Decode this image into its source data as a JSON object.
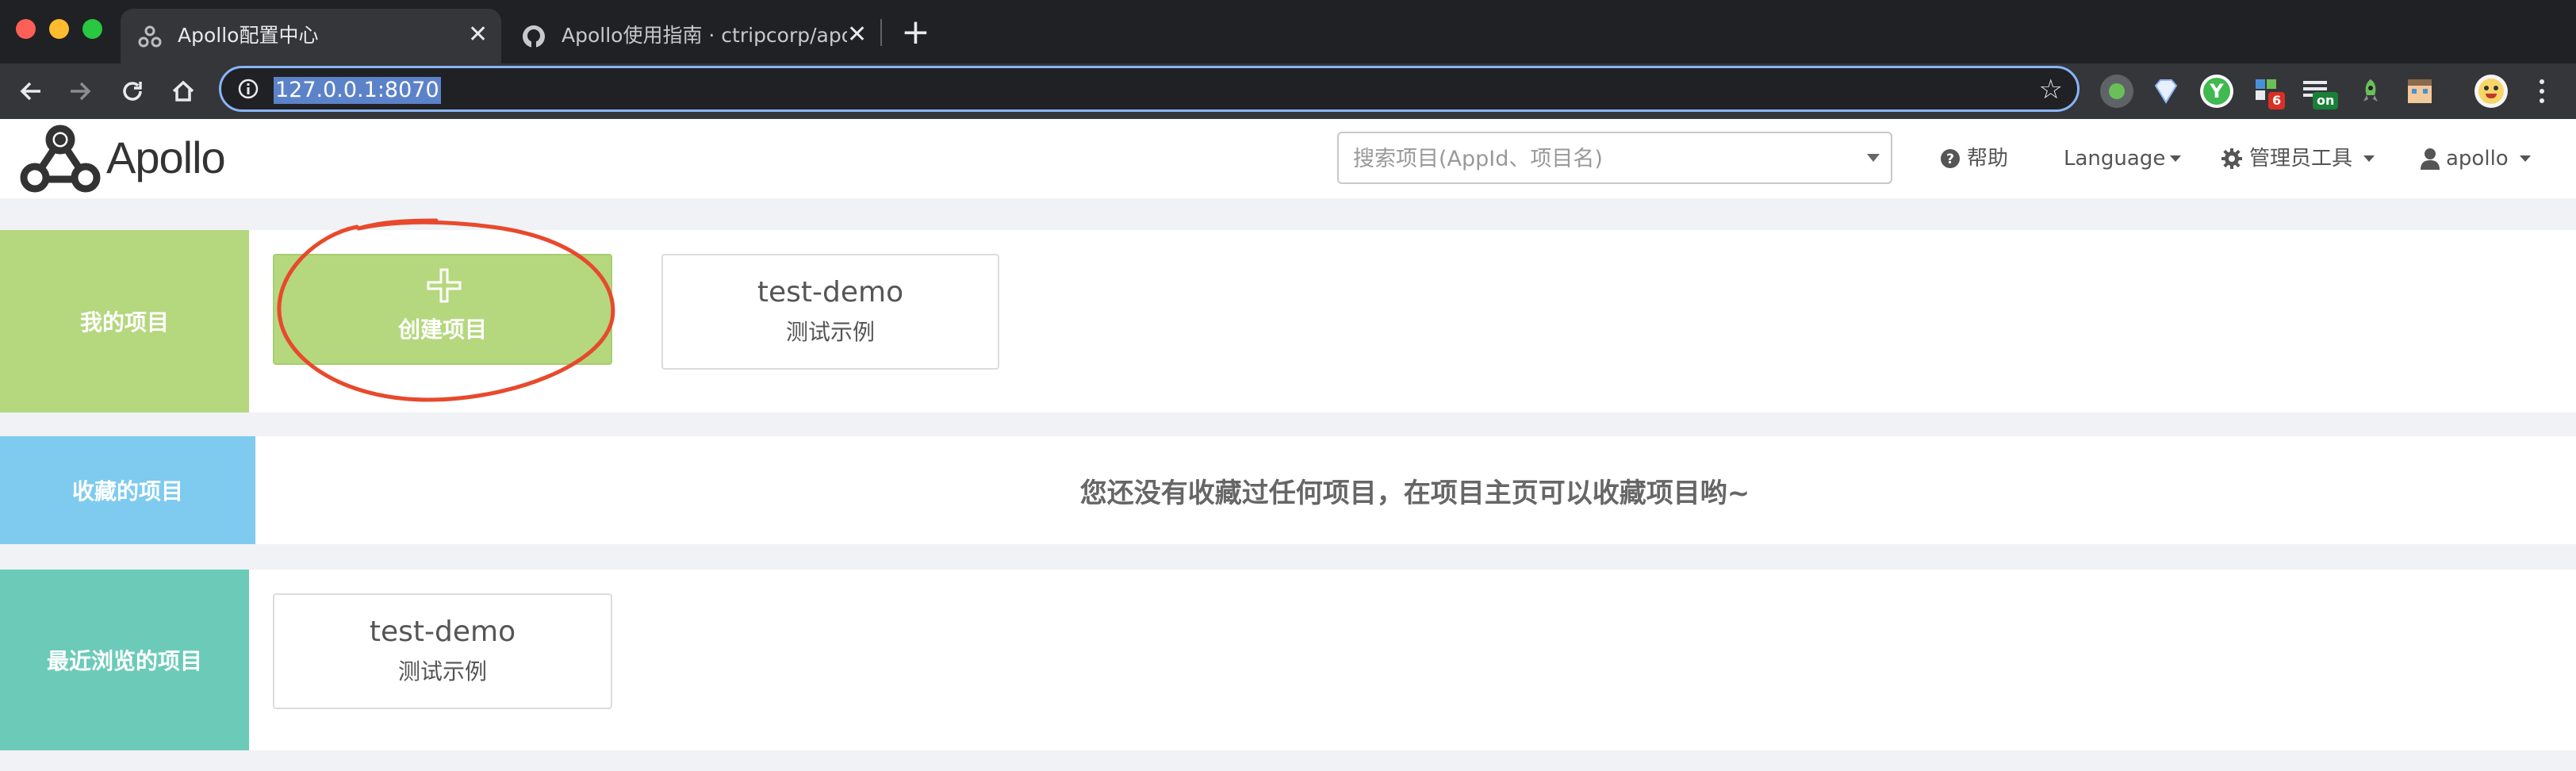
{
  "browser": {
    "tabs": [
      {
        "title": "Apollo配置中心",
        "active": true
      },
      {
        "title": "Apollo使用指南 · ctripcorp/apollo",
        "active": false
      }
    ],
    "url": "127.0.0.1:8070",
    "extensions": [
      {
        "icon": "green-dot-icon"
      },
      {
        "icon": "diamond-icon"
      },
      {
        "icon": "y-logo-icon"
      },
      {
        "icon": "puzzle-icon",
        "badge": "6"
      },
      {
        "icon": "list-icon",
        "badge": "on"
      },
      {
        "icon": "rocket-icon"
      },
      {
        "icon": "pixel-face-icon"
      },
      {
        "icon": "avatar-icon"
      }
    ]
  },
  "header": {
    "logo_text": "Apollo",
    "search_placeholder": "搜索项目(AppId、项目名)",
    "help": "帮助",
    "language": "Language",
    "admin_tools": "管理员工具",
    "user": "apollo"
  },
  "my_projects": {
    "label": "我的项目",
    "create_label": "创建项目",
    "projects": [
      {
        "app_id": "test-demo",
        "name": "测试示例"
      }
    ]
  },
  "favorites": {
    "label": "收藏的项目",
    "empty_message": "您还没有收藏过任何项目，在项目主页可以收藏项目哟~"
  },
  "recent": {
    "label": "最近浏览的项目",
    "projects": [
      {
        "app_id": "test-demo",
        "name": "测试示例"
      }
    ]
  },
  "colors": {
    "my_projects": "#b5d77e",
    "favorites": "#7ecbef",
    "recent": "#6ccbb8",
    "annotation": "#e8492c"
  }
}
